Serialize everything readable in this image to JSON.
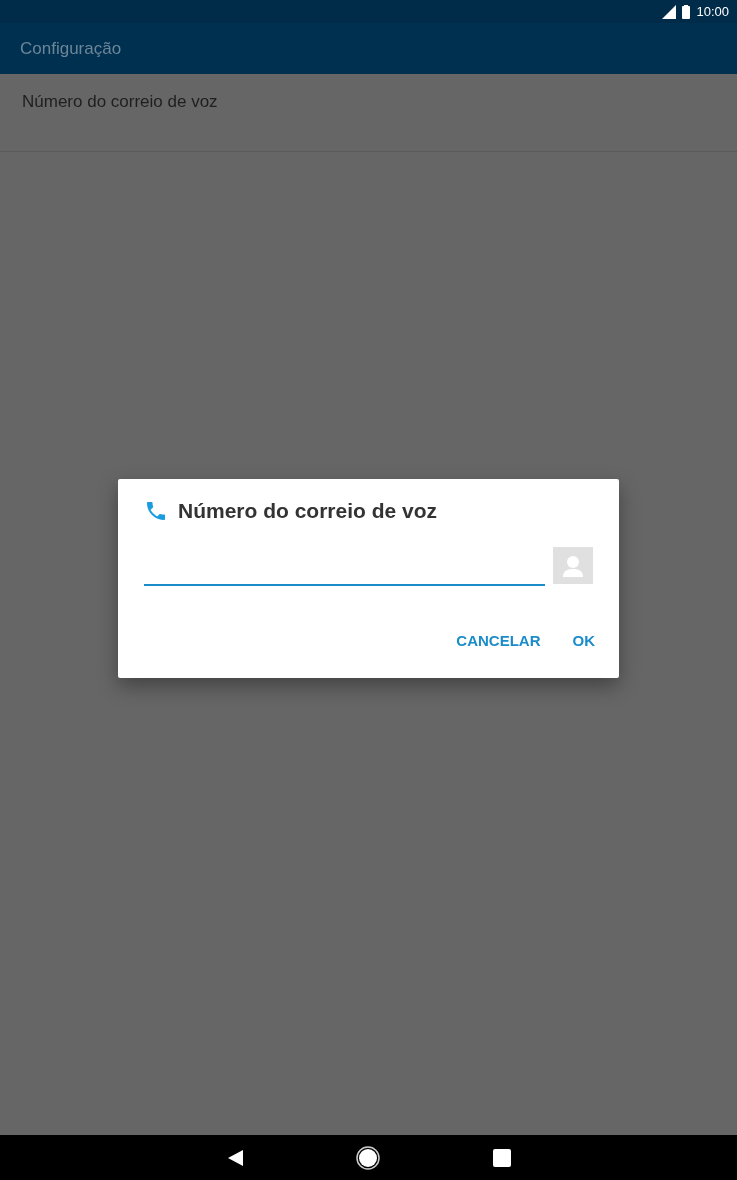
{
  "status_bar": {
    "time": "10:00"
  },
  "app_bar": {
    "title": "Configuração"
  },
  "settings_items": [
    {
      "label": "Número do correio de voz"
    }
  ],
  "dialog": {
    "title": "Número do correio de voz",
    "buttons": [
      "CANCELAR",
      "OK"
    ]
  }
}
